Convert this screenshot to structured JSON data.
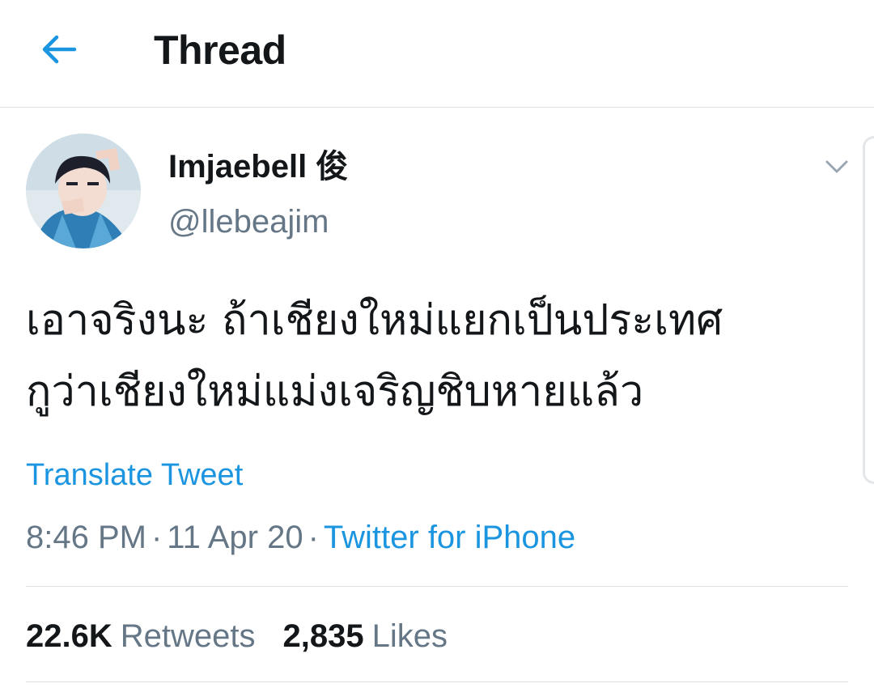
{
  "header": {
    "title": "Thread",
    "back_icon": "arrow-left-icon",
    "accent_color": "#1b95e0"
  },
  "tweet": {
    "author": {
      "display_name": "Imjaebell 俊",
      "handle": "@llebeajim"
    },
    "text_lines": [
      "เอาจริงนะ ถ้าเชียงใหม่แยกเป็นประเทศ",
      "กูว่าเชียงใหม่แม่งเจริญชิบหายแล้ว"
    ],
    "translate_label": "Translate Tweet",
    "time": "8:46 PM",
    "date": "11 Apr 20",
    "separator": "·",
    "source": "Twitter for iPhone",
    "more_icon": "chevron-down-icon"
  },
  "stats": {
    "retweets_count": "22.6K",
    "retweets_label": "Retweets",
    "likes_count": "2,835",
    "likes_label": "Likes"
  }
}
